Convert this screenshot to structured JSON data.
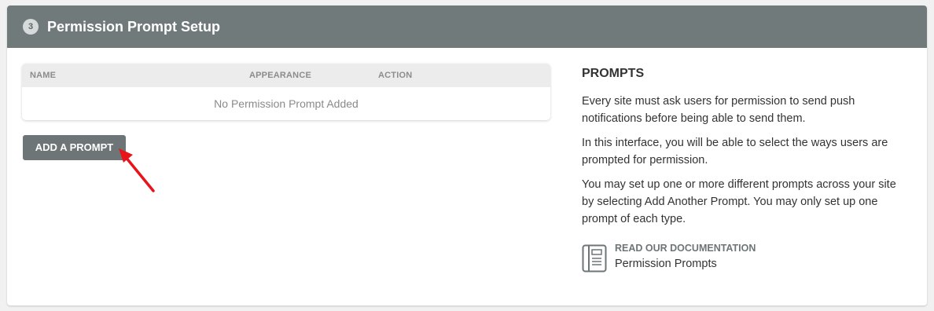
{
  "header": {
    "step": "3",
    "title": "Permission Prompt Setup"
  },
  "table": {
    "columns": [
      "NAME",
      "APPEARANCE",
      "ACTION"
    ],
    "empty_text": "No Permission Prompt Added"
  },
  "add_button": {
    "label": "ADD A PROMPT"
  },
  "sidebar": {
    "title": "PROMPTS",
    "paragraphs": [
      "Every site must ask users for permission to send push notifications before being able to send them.",
      "In this interface, you will be able to select the ways users are prompted for permission.",
      "You may set up one or more different prompts across your site by selecting Add Another Prompt. You may only set up one prompt of each type."
    ]
  },
  "docs": {
    "kicker": "READ OUR DOCUMENTATION",
    "link": "Permission Prompts",
    "icon": "document-icon"
  },
  "colors": {
    "header_bg": "#717a7b",
    "button_bg": "#6d7577",
    "annotation_arrow": "#e8141a"
  }
}
